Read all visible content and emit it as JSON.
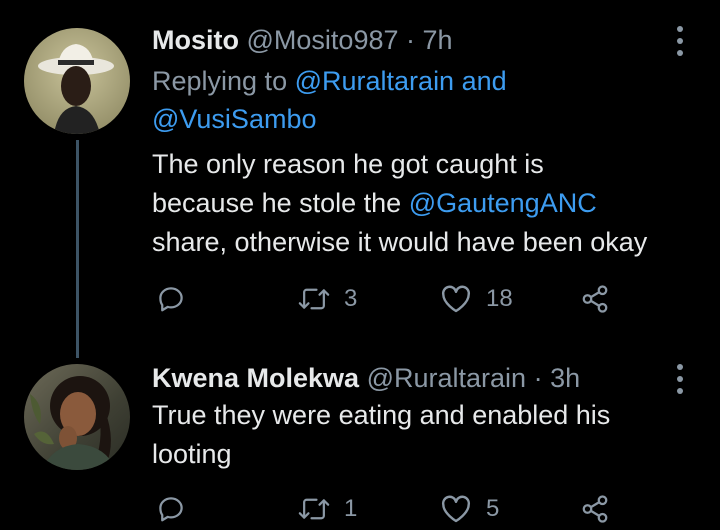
{
  "tweets": [
    {
      "name": "Mosito",
      "handle": "@Mosito987",
      "separator": "·",
      "time": "7h",
      "replying_prefix": "Replying to",
      "replying_mention_1": "@Ruraltarain",
      "replying_and": "and",
      "replying_mention_2": "@VusiSambo",
      "text_1": "The only reason he got caught is",
      "text_2a": "because he stole the",
      "text_2_mention": "@GautengANC",
      "text_3": "share, otherwise it would have been okay",
      "retweets": "3",
      "likes": "18"
    },
    {
      "name": "Kwena Molekwa",
      "handle": "@Ruraltarain",
      "separator": "·",
      "time": "3h",
      "text_1": "True they were eating and enabled his",
      "text_2": "looting",
      "retweets": "1",
      "likes": "5"
    }
  ],
  "colors": {
    "background": "#000000",
    "text": "#e7e9ea",
    "secondary": "#8b98a5",
    "link": "#3d9cf0",
    "thread_line": "#3d5466"
  },
  "icons": [
    "reply-icon",
    "retweet-icon",
    "like-icon",
    "share-icon",
    "more-options-icon"
  ]
}
